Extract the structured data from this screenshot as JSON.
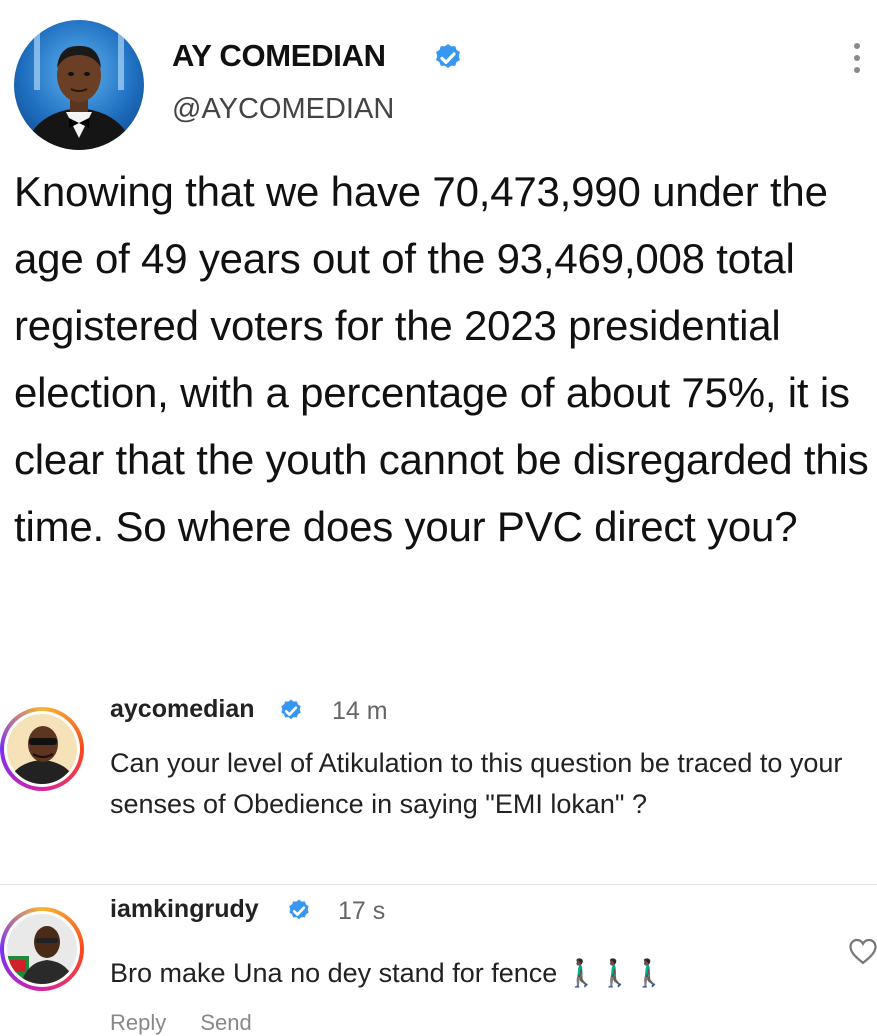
{
  "tweet": {
    "display_name": "AY COMEDIAN",
    "handle": "@AYCOMEDIAN",
    "text": "Knowing that we have 70,473,990 under the age of 49 years out of the 93,469,008 total registered voters for the 2023 presidential election, with a percentage of about 75%, it is clear that the youth cannot be disregarded this time. So where does your PVC direct you?",
    "verified_icon": "verified-badge-icon",
    "more_icon": "more-vertical-icon"
  },
  "comments": [
    {
      "username": "aycomedian",
      "time": "14 m",
      "text": "Can your level of Atikulation to this question be traced to your senses of Obedience in saying \"EMI lokan\" ?"
    },
    {
      "username": "iamkingrudy",
      "time": "17 s",
      "text": "Bro make Una no dey stand for fence 🚶🏿‍♂️🚶🏿‍♂️🚶🏿‍♂️",
      "actions": "Reply Send"
    }
  ],
  "colors": {
    "verified": "#3897f0",
    "story_ring_start": "#f7b733",
    "story_ring_mid": "#d6249f",
    "text": "#111111",
    "meta": "#666666"
  }
}
